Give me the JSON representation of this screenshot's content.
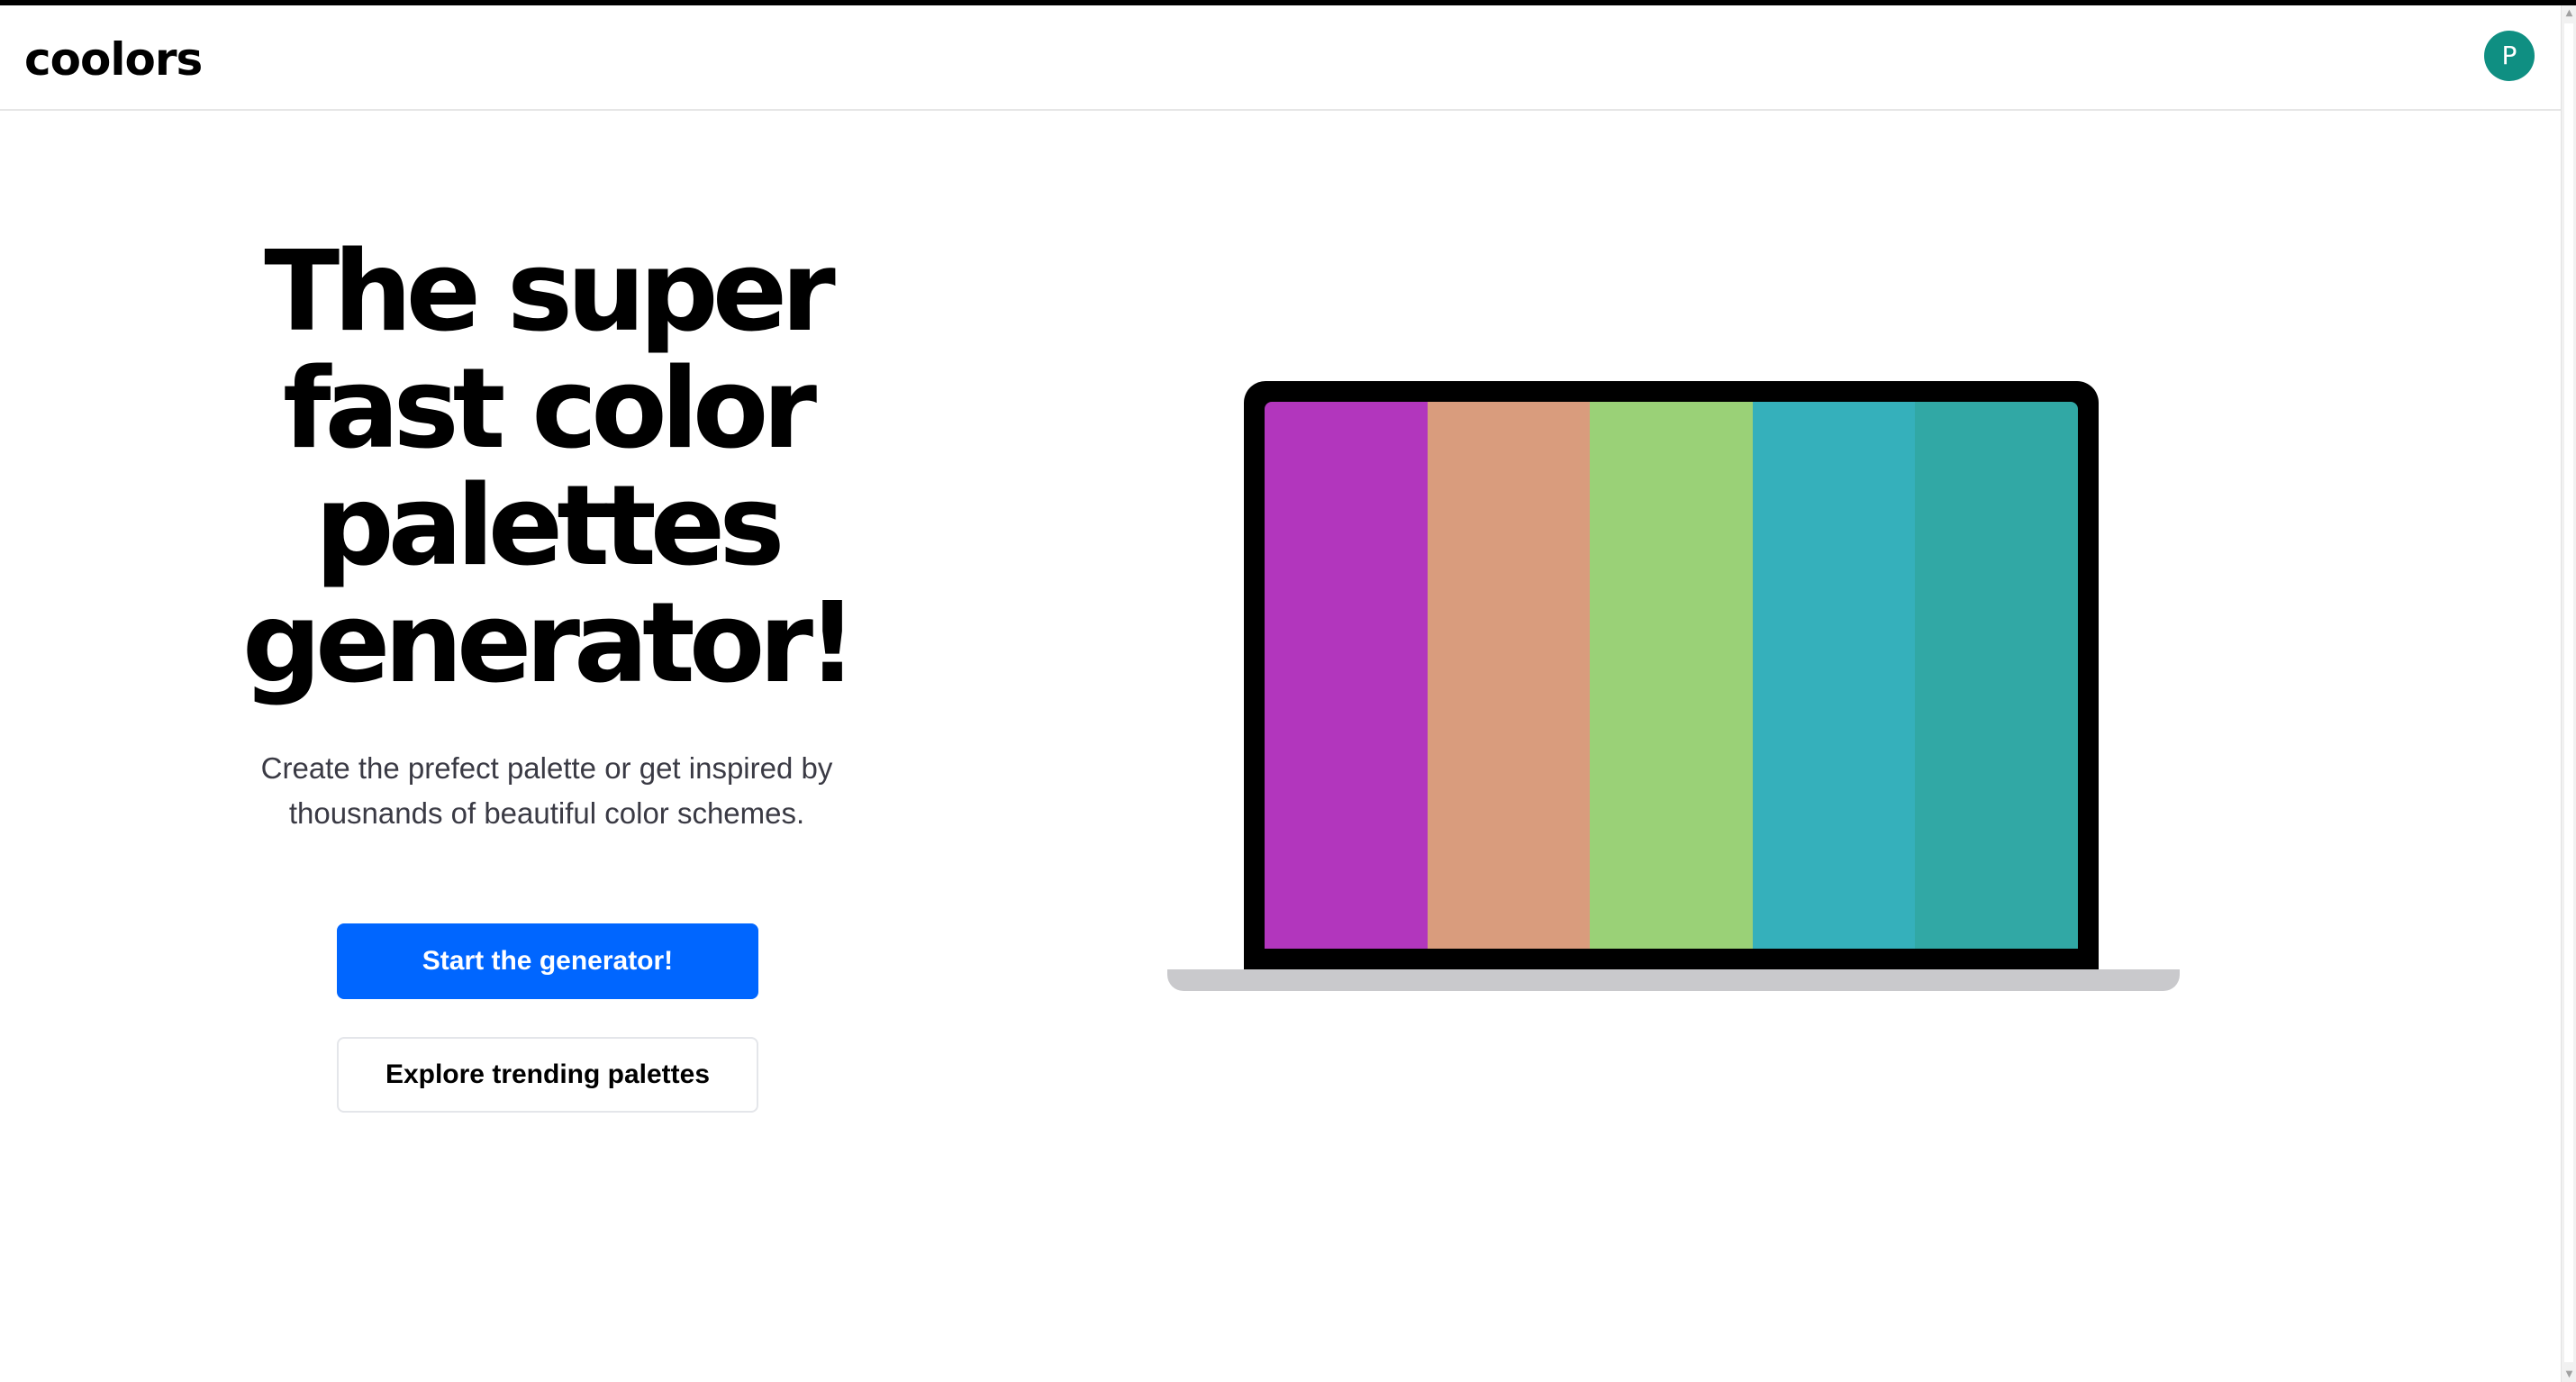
{
  "header": {
    "logo": "coolors",
    "avatar_initial": "P"
  },
  "hero": {
    "headline": "The super fast color palettes generator!",
    "subtitle": "Create the prefect palette or get inspired by thousnands of beautiful color schemes.",
    "primary_button": "Start the generator!",
    "secondary_button": "Explore trending palettes"
  },
  "colors": {
    "accent": "#0066ff",
    "avatar": "#0f8f82"
  },
  "palette": [
    {
      "name": "magenta",
      "hex": "#b236bd"
    },
    {
      "name": "peach",
      "hex": "#d99c7d"
    },
    {
      "name": "light-green",
      "hex": "#9ad177"
    },
    {
      "name": "teal-blue",
      "hex": "#35b0bb"
    },
    {
      "name": "teal",
      "hex": "#31a8a5"
    }
  ]
}
